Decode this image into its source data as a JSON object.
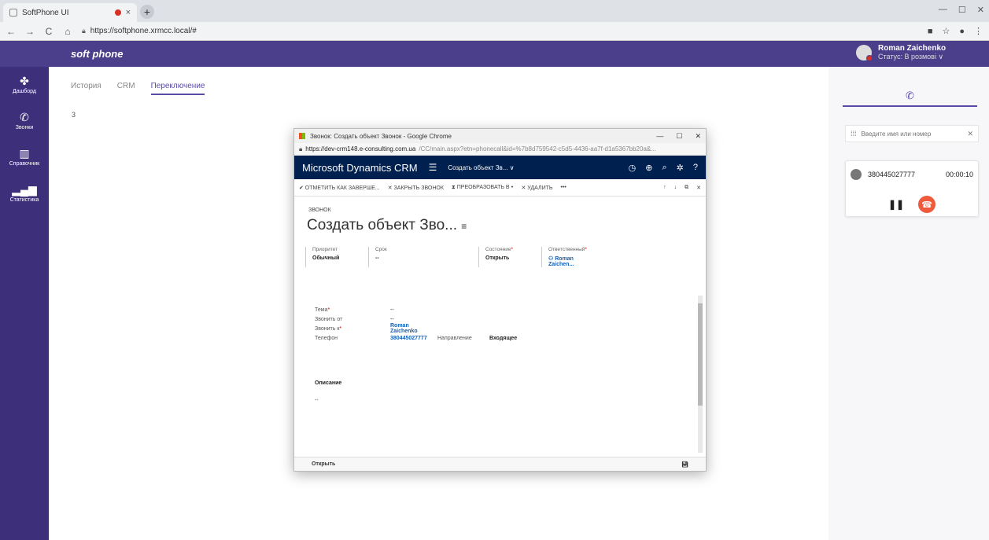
{
  "browser": {
    "tab_title": "SoftPhone UI",
    "tab_close": "×",
    "new_tab": "+",
    "win_min": "—",
    "win_max": "☐",
    "win_close": "✕",
    "url": "https://softphone.xrmcc.local/#"
  },
  "header": {
    "brand": "soft phone",
    "user_name": "Roman Zaichenko",
    "user_status": "Статус: В розмові ∨",
    "accent": "#4b3e8a"
  },
  "sidebar": {
    "items": [
      {
        "label": "Дашборд"
      },
      {
        "label": "Звонки"
      },
      {
        "label": "Справочник"
      },
      {
        "label": "Статистика"
      }
    ]
  },
  "main": {
    "tabs": [
      {
        "label": "История"
      },
      {
        "label": "CRM"
      },
      {
        "label": "Переключение"
      }
    ],
    "count": "3"
  },
  "right_panel": {
    "search_placeholder": "Введите имя или номер",
    "call": {
      "number": "380445027777",
      "duration": "00:00:10"
    }
  },
  "popup": {
    "window_title": "Звонок: Создать объект Звонок - Google Chrome",
    "min": "—",
    "max": "☐",
    "close": "✕",
    "url_domain": "https://dev-crm148.e-consulting.com.ua",
    "url_path": "/CC/main.aspx?etn=phonecall&id=%7b8d759542-c5d5-4436-aa7f-d1a5367bb20a&...",
    "crm_brand": "Microsoft Dynamics CRM",
    "crm_breadcrumb": "Создать объект Зв...  ∨",
    "commands": {
      "mark_complete": "✔ ОТМЕТИТЬ КАК ЗАВЕРШЕ...",
      "close_call": "✕ ЗАКРЫТЬ ЗВОНОК",
      "convert": "⧗ ПРЕОБРАЗОВАТЬ В ▾",
      "delete": "✕ УДАЛИТЬ",
      "more": "•••"
    },
    "record_type": "ЗВОНОК",
    "record_title": "Создать объект Зво...",
    "header_fields": {
      "priority_label": "Приоритет",
      "priority_value": "Обычный",
      "due_label": "Срок",
      "due_value": "--",
      "status_label": "Состояние",
      "status_value": "Открыть",
      "owner_label": "Ответственный",
      "owner_value": "Roman Zaichen..."
    },
    "form": {
      "subject_label": "Тема",
      "subject_value": "--",
      "from_label": "Звонить от",
      "from_value": "--",
      "to_label": "Звонить к",
      "to_value": "Roman Zaichenko",
      "phone_label": "Телефон",
      "phone_value": "380445027777",
      "direction_label": "Направление",
      "direction_value": "Входящее"
    },
    "description_label": "Описание",
    "description_value": "--",
    "footer_status": "Открыть"
  }
}
